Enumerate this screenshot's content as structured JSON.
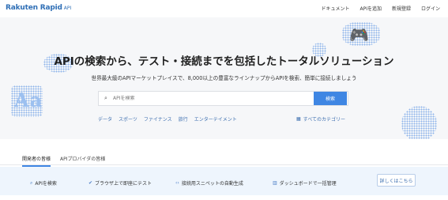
{
  "header": {
    "logo_main": "Rakuten Rapid",
    "logo_sub": "API",
    "nav": [
      "ドキュメント",
      "APIを追加",
      "新規登録",
      "ログイン"
    ]
  },
  "hero": {
    "title": "APIの検索から、テスト・接続までを包括したトータルソリューション",
    "subtitle": "世界最大級のAPIマーケットプレイスで、8,000以上の豊富なラインナップからAPIを検索、簡単に接続しましょう",
    "decor_text": "Aa"
  },
  "search": {
    "placeholder": "APIを検索",
    "button": "検索"
  },
  "categories": [
    "データ",
    "スポーツ",
    "ファイナンス",
    "旅行",
    "エンターテイメント"
  ],
  "all_categories": "すべてのカテゴリー",
  "tabs": [
    {
      "label": "開発者の皆様",
      "active": true
    },
    {
      "label": "APIプロバイダの皆様",
      "active": false
    }
  ],
  "features": [
    {
      "icon": "search-icon",
      "label": "APIを検索"
    },
    {
      "icon": "check-icon",
      "label": "ブラウザ上で即座にテスト"
    },
    {
      "icon": "code-icon",
      "label": "接続用スニペットの自動生成"
    },
    {
      "icon": "chart-icon",
      "label": "ダッシュボードで一括管理"
    }
  ],
  "more_button": "詳しくはこちら",
  "colors": {
    "accent": "#3f86e3",
    "link": "#3d6fb0",
    "band": "#eef5fd"
  }
}
